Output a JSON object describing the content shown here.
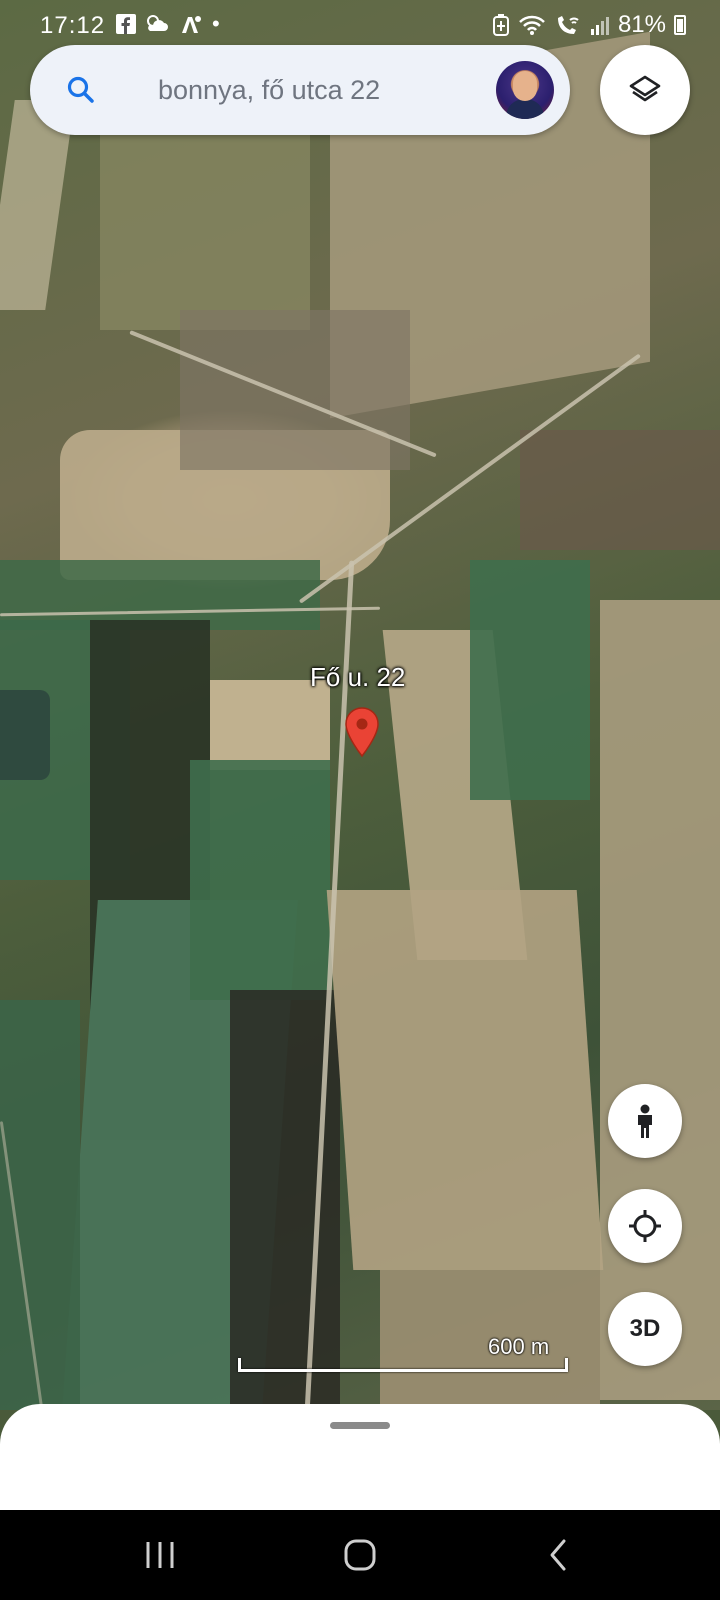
{
  "status_bar": {
    "time": "17:12",
    "notification_icons": [
      "facebook-icon",
      "weather-icon",
      "driving-icon",
      "dot-icon"
    ],
    "system_icons": [
      "battery-saver-icon",
      "wifi-icon",
      "wifi-calling-icon",
      "signal-icon"
    ],
    "battery_percent": "81%"
  },
  "search": {
    "query": "bonnya, fő utca 22",
    "icon": "search-icon"
  },
  "layers_button": {
    "icon": "layers-icon"
  },
  "map": {
    "pin_label": "Fő u. 22",
    "pin_color": "#ea4335",
    "scale_label": "600 m"
  },
  "controls": {
    "street_view_icon": "pegman-icon",
    "my_location_icon": "my-location-icon",
    "three_d_label": "3D"
  },
  "nav_bar": {
    "icons": [
      "recent-apps-icon",
      "home-icon",
      "back-icon"
    ]
  }
}
